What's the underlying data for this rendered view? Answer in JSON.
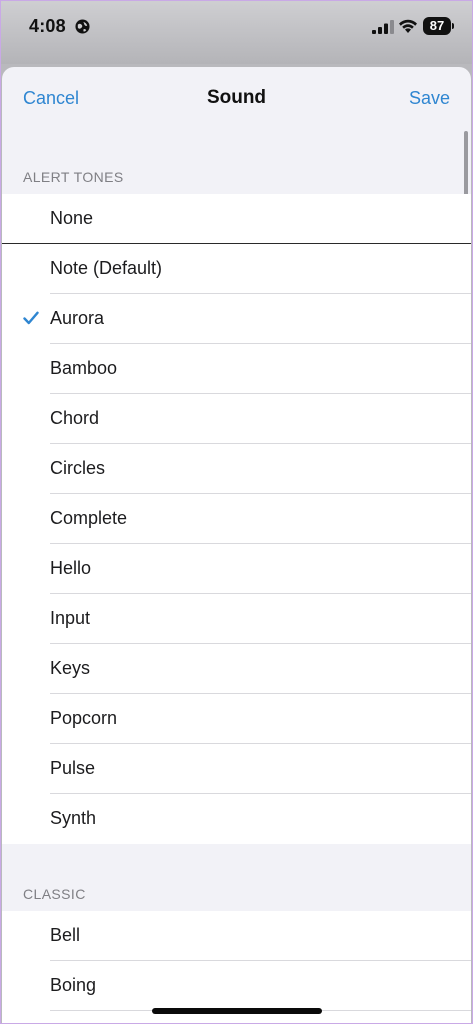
{
  "status_bar": {
    "time": "4:08",
    "battery": "87"
  },
  "nav": {
    "cancel": "Cancel",
    "title": "Sound",
    "save": "Save"
  },
  "alert_tones": {
    "header": "ALERT TONES",
    "items": [
      {
        "label": "None",
        "selected": false
      },
      {
        "label": "Note (Default)",
        "selected": false
      },
      {
        "label": "Aurora",
        "selected": true
      },
      {
        "label": "Bamboo",
        "selected": false
      },
      {
        "label": "Chord",
        "selected": false
      },
      {
        "label": "Circles",
        "selected": false
      },
      {
        "label": "Complete",
        "selected": false
      },
      {
        "label": "Hello",
        "selected": false
      },
      {
        "label": "Input",
        "selected": false
      },
      {
        "label": "Keys",
        "selected": false
      },
      {
        "label": "Popcorn",
        "selected": false
      },
      {
        "label": "Pulse",
        "selected": false
      },
      {
        "label": "Synth",
        "selected": false
      }
    ]
  },
  "classic": {
    "header": "CLASSIC",
    "items": [
      {
        "label": "Bell",
        "selected": false
      },
      {
        "label": "Boing",
        "selected": false
      }
    ]
  },
  "colors": {
    "accent": "#2f86d1"
  }
}
